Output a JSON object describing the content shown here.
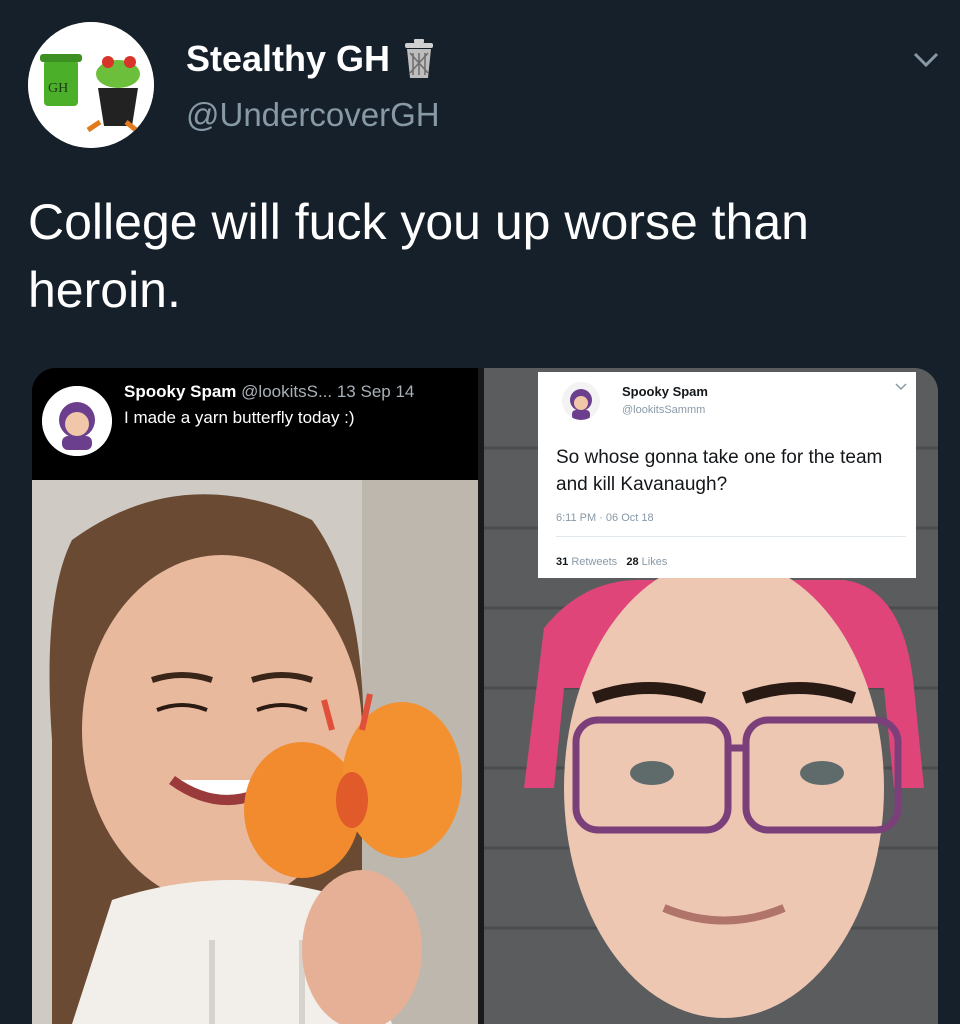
{
  "tweet": {
    "display_name": "Stealthy GH",
    "handle": "@UndercoverGH",
    "text": "College will fuck you up worse than heroin.",
    "avatar_icon": "trash-can-frog-avatar",
    "name_badge_icon": "trash-can-icon",
    "avatar_logo_text": "GH"
  },
  "embedded_left": {
    "display_name": "Spooky Spam",
    "handle": "@lookitsS...",
    "date": "13 Sep 14",
    "text": "I made a yarn butterfly today :)"
  },
  "embedded_right": {
    "display_name": "Spooky Spam",
    "handle": "@lookitsSammm",
    "text": "So whose gonna take one for the team and kill Kavanaugh?",
    "timestamp": "6:11 PM · 06 Oct 18",
    "retweets_count": "31",
    "retweets_label": "Retweets",
    "likes_count": "28",
    "likes_label": "Likes"
  },
  "colors": {
    "background": "#15202b",
    "secondary_text": "#8899a6"
  }
}
